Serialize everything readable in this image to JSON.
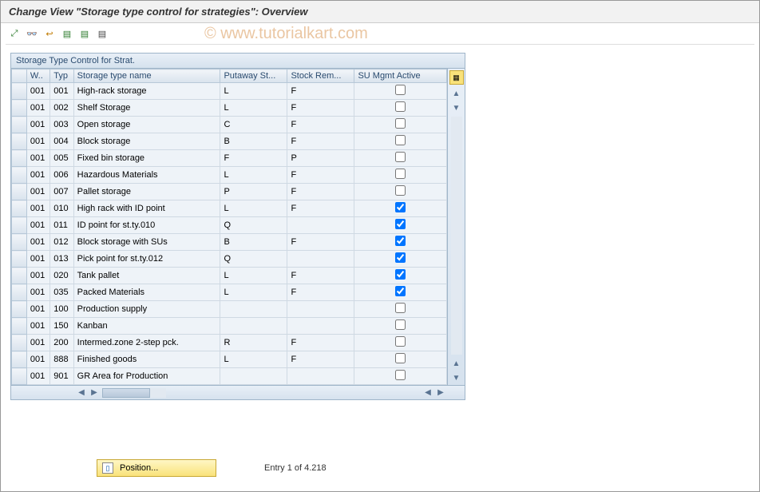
{
  "watermark": "© www.tutorialkart.com",
  "header": {
    "title": "Change View \"Storage type control for strategies\": Overview"
  },
  "toolbar": {
    "icons": [
      {
        "name": "expand-icon",
        "glyph": "⤢",
        "color": "#2a7a2a"
      },
      {
        "name": "glasses-icon",
        "glyph": "👓",
        "color": "#1a5aa0"
      },
      {
        "name": "undo-icon",
        "glyph": "↩",
        "color": "#c07a00"
      },
      {
        "name": "save-icon",
        "glyph": "▤",
        "color": "#2a7a2a"
      },
      {
        "name": "save2-icon",
        "glyph": "▤",
        "color": "#2a7a2a"
      },
      {
        "name": "list-icon",
        "glyph": "▤",
        "color": "#444"
      }
    ]
  },
  "panel": {
    "title": "Storage Type Control for Strat.",
    "columns": {
      "sel": "",
      "whs": "W..",
      "typ": "Typ",
      "name": "Storage type name",
      "putaway": "Putaway St...",
      "stock": "Stock Rem...",
      "su": "SU Mgmt Active"
    },
    "rows": [
      {
        "w": "001",
        "typ": "001",
        "name": "High-rack storage",
        "put": "L",
        "stk": "F",
        "su": false
      },
      {
        "w": "001",
        "typ": "002",
        "name": "Shelf Storage",
        "put": "L",
        "stk": "F",
        "su": false
      },
      {
        "w": "001",
        "typ": "003",
        "name": "Open storage",
        "put": "C",
        "stk": "F",
        "su": false
      },
      {
        "w": "001",
        "typ": "004",
        "name": "Block storage",
        "put": "B",
        "stk": "F",
        "su": false
      },
      {
        "w": "001",
        "typ": "005",
        "name": "Fixed bin storage",
        "put": "F",
        "stk": "P",
        "su": false
      },
      {
        "w": "001",
        "typ": "006",
        "name": "Hazardous Materials",
        "put": "L",
        "stk": "F",
        "su": false
      },
      {
        "w": "001",
        "typ": "007",
        "name": "Pallet storage",
        "put": "P",
        "stk": "F",
        "su": false
      },
      {
        "w": "001",
        "typ": "010",
        "name": "High rack with ID point",
        "put": "L",
        "stk": "F",
        "su": true
      },
      {
        "w": "001",
        "typ": "011",
        "name": "ID point for st.ty.010",
        "put": "Q",
        "stk": "",
        "su": true
      },
      {
        "w": "001",
        "typ": "012",
        "name": "Block storage with SUs",
        "put": "B",
        "stk": "F",
        "su": true
      },
      {
        "w": "001",
        "typ": "013",
        "name": "Pick point for st.ty.012",
        "put": "Q",
        "stk": "",
        "su": true
      },
      {
        "w": "001",
        "typ": "020",
        "name": "Tank pallet",
        "put": "L",
        "stk": "F",
        "su": true
      },
      {
        "w": "001",
        "typ": "035",
        "name": "Packed Materials",
        "put": "L",
        "stk": "F",
        "su": true
      },
      {
        "w": "001",
        "typ": "100",
        "name": "Production supply",
        "put": "",
        "stk": "",
        "su": false
      },
      {
        "w": "001",
        "typ": "150",
        "name": "Kanban",
        "put": "",
        "stk": "",
        "su": false
      },
      {
        "w": "001",
        "typ": "200",
        "name": "Intermed.zone 2-step pck.",
        "put": "R",
        "stk": "F",
        "su": false
      },
      {
        "w": "001",
        "typ": "888",
        "name": "Finished goods",
        "put": "L",
        "stk": "F",
        "su": false
      },
      {
        "w": "001",
        "typ": "901",
        "name": "GR Area for Production",
        "put": "",
        "stk": "",
        "su": false
      }
    ]
  },
  "footer": {
    "position_label": "Position...",
    "entry_info": "Entry 1 of 4.218"
  }
}
